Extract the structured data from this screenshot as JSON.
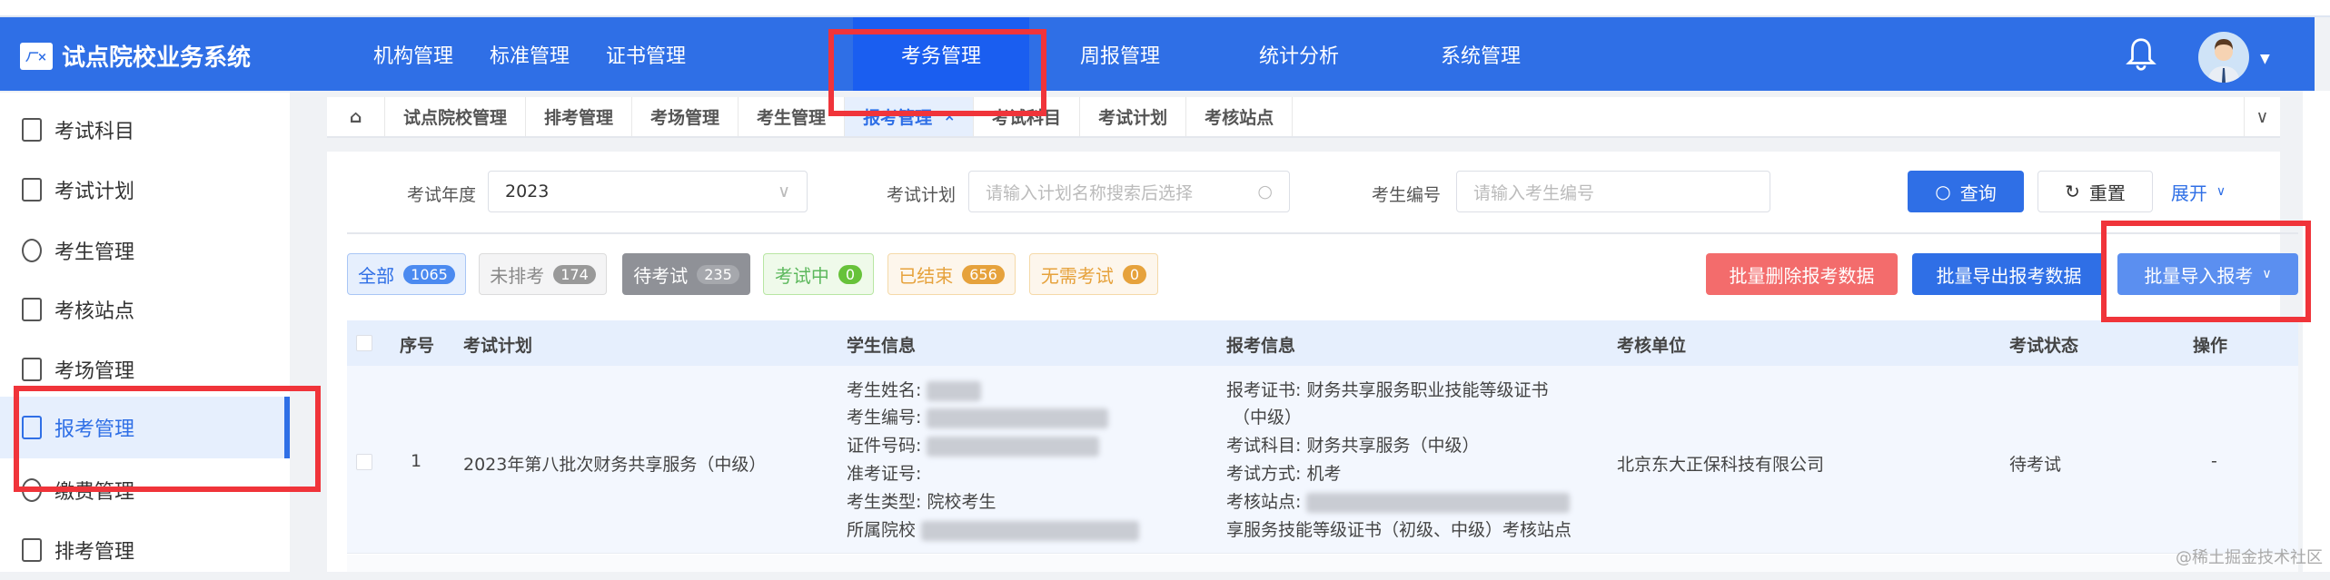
{
  "app": {
    "title": "试点院校业务系统",
    "logo_text": "ㄏ×"
  },
  "nav": [
    {
      "label": "机构管理"
    },
    {
      "label": "标准管理"
    },
    {
      "label": "证书管理"
    },
    {
      "label": "考务管理",
      "active": true
    },
    {
      "label": "周报管理"
    },
    {
      "label": "统计分析"
    },
    {
      "label": "系统管理"
    }
  ],
  "sidebar": [
    {
      "label": "考试科目",
      "icon": "book-icon"
    },
    {
      "label": "考试计划",
      "icon": "clipboard-list-icon"
    },
    {
      "label": "考生管理",
      "icon": "user-circle-icon"
    },
    {
      "label": "考核站点",
      "icon": "map-pin-icon"
    },
    {
      "label": "考场管理",
      "icon": "layout-icon"
    },
    {
      "label": "报考管理",
      "icon": "clipboard-icon",
      "active": true
    },
    {
      "label": "缴费管理",
      "icon": "payment-icon"
    },
    {
      "label": "排考管理",
      "icon": "calendar-icon"
    }
  ],
  "tabs": [
    {
      "label": "试点院校管理"
    },
    {
      "label": "排考管理"
    },
    {
      "label": "考场管理"
    },
    {
      "label": "考生管理"
    },
    {
      "label": "报考管理",
      "active": true,
      "close": "×"
    },
    {
      "label": "考试科目"
    },
    {
      "label": "考试计划"
    },
    {
      "label": "考核站点"
    }
  ],
  "filters": {
    "year_label": "考试年度",
    "year_value": "2023",
    "plan_label": "考试计划",
    "plan_placeholder": "请输入计划名称搜索后选择",
    "id_label": "考生编号",
    "id_placeholder": "请输入考生编号",
    "search": "查询",
    "reset": "重置",
    "expand": "展开"
  },
  "status_tags": [
    {
      "label": "全部",
      "count": "1065"
    },
    {
      "label": "未排考",
      "count": "174"
    },
    {
      "label": "待考试",
      "count": "235"
    },
    {
      "label": "考试中",
      "count": "0"
    },
    {
      "label": "已结束",
      "count": "656"
    },
    {
      "label": "无需考试",
      "count": "0"
    }
  ],
  "actions": {
    "delete": "批量删除报考数据",
    "export": "批量导出报考数据",
    "import": "批量导入报考"
  },
  "table": {
    "headers": [
      "序号",
      "考试计划",
      "学生信息",
      "报考信息",
      "考核单位",
      "考试状态",
      "操作"
    ],
    "rows": [
      {
        "index": "1",
        "plan": "2023年第八批次财务共享服务（中级）",
        "student": [
          "考生姓名:",
          "考生编号:",
          "证件号码:",
          "准考证号:",
          "考生类型: 院校考生",
          "所属院校"
        ],
        "exam": [
          "报考证书: 财务共享服务职业技能等级证书",
          "（中级）",
          "考试科目: 财务共享服务（中级）",
          "考试方式: 机考",
          "考核站点:",
          "享服务技能等级证书（初级、中级）考核站点"
        ],
        "unit": "北京东大正保科技有限公司",
        "status": "待考试",
        "op": "-"
      }
    ]
  },
  "watermark": "@稀土掘金技术社区",
  "colors": {
    "primary": "#2f6fe6",
    "danger": "#f36c6c",
    "highlight": "#f0343a"
  }
}
